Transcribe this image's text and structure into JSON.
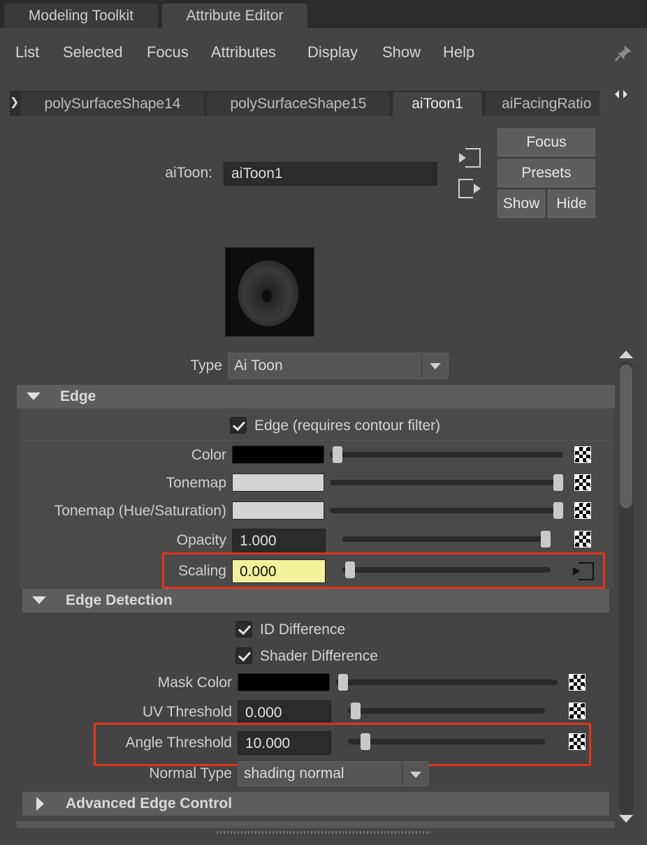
{
  "panel_tabs": [
    "Modeling Toolkit",
    "Attribute Editor"
  ],
  "menu": [
    "List",
    "Selected",
    "Focus",
    "Attributes",
    "Display",
    "Show",
    "Help"
  ],
  "node_tabs": [
    "polySurfaceShape14",
    "polySurfaceShape15",
    "aiToon1",
    "aiFacingRatio"
  ],
  "node": {
    "label": "aiToon:",
    "name": "aiToon1"
  },
  "buttons": {
    "focus": "Focus",
    "presets": "Presets",
    "show": "Show",
    "hide": "Hide"
  },
  "type": {
    "label": "Type",
    "value": "Ai Toon"
  },
  "edge_section": {
    "title": "Edge",
    "checkbox_label": "Edge (requires contour filter)",
    "checkbox_checked": true,
    "color_label": "Color",
    "color_hex": "#000000",
    "tonemap_label": "Tonemap",
    "tonemap_hex": "#d4d4d4",
    "tonemap_hs_label": "Tonemap (Hue/Saturation)",
    "tonemap_hs_hex": "#d4d4d4",
    "opacity_label": "Opacity",
    "opacity_value": "1.000",
    "scaling_label": "Scaling",
    "scaling_value": "0.000"
  },
  "edge_detection_section": {
    "title": "Edge Detection",
    "id_diff_label": "ID Difference",
    "shader_diff_label": "Shader Difference",
    "mask_color_label": "Mask Color",
    "mask_color_hex": "#000000",
    "uv_threshold_label": "UV Threshold",
    "uv_threshold_value": "0.000",
    "angle_threshold_label": "Angle Threshold",
    "angle_threshold_value": "10.000",
    "normal_type_label": "Normal Type",
    "normal_type_value": "shading normal"
  },
  "advanced_section": {
    "title": "Advanced Edge Control"
  },
  "colors": {
    "highlight_field": "#f2f29a",
    "annotation_red": "#e4331c"
  }
}
